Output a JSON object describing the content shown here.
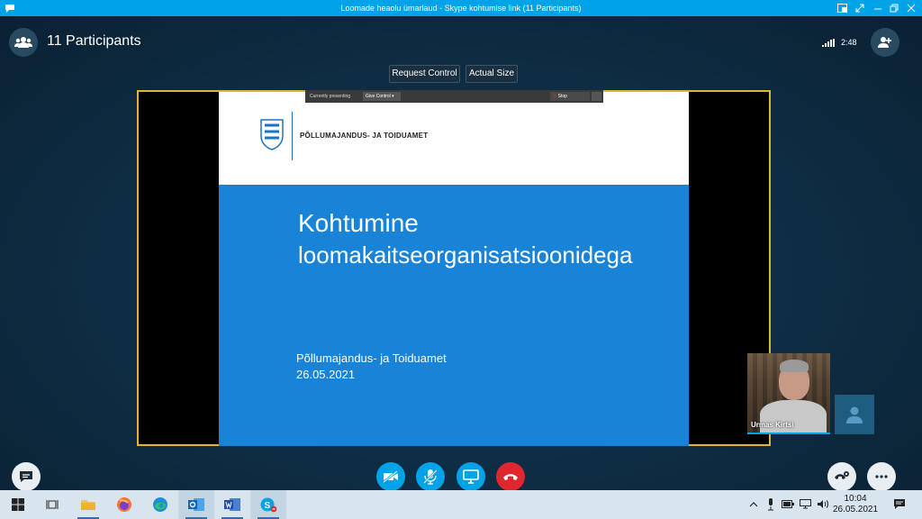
{
  "window": {
    "title": "Loomade heaolu ümarlaud -  Skype kohtumise link (11 Participants)",
    "accent": "#00a2e8"
  },
  "header": {
    "participants_label": "11 Participants",
    "call_duration": "2:48"
  },
  "share_controls": {
    "request_control": "Request Control",
    "actual_size": "Actual Size"
  },
  "presenting_bar": {
    "currently_presenting": "Currently presenting",
    "give_control": "Give Control",
    "stop_presenting": "Stop Presenting"
  },
  "slide": {
    "org_header": "Põllumajandus- ja Toiduamet",
    "title_line1": "Kohtumine",
    "title_line2": "loomakaitseorganisatsioonidega",
    "org_footer": "Põllumajandus- ja Toiduamet",
    "date": "26.05.2021",
    "accent": "#1983d8"
  },
  "video": {
    "participant_name": "Urmas Kirtsi"
  },
  "call_controls": {
    "buttons": [
      "video-off",
      "mute",
      "share-screen",
      "hang-up"
    ],
    "hangup_color": "#e0262e"
  },
  "taskbar": {
    "time": "10:04",
    "date": "26.05.2021",
    "apps": [
      "task-view",
      "file-explorer",
      "firefox",
      "edge",
      "outlook",
      "word",
      "skype"
    ]
  }
}
